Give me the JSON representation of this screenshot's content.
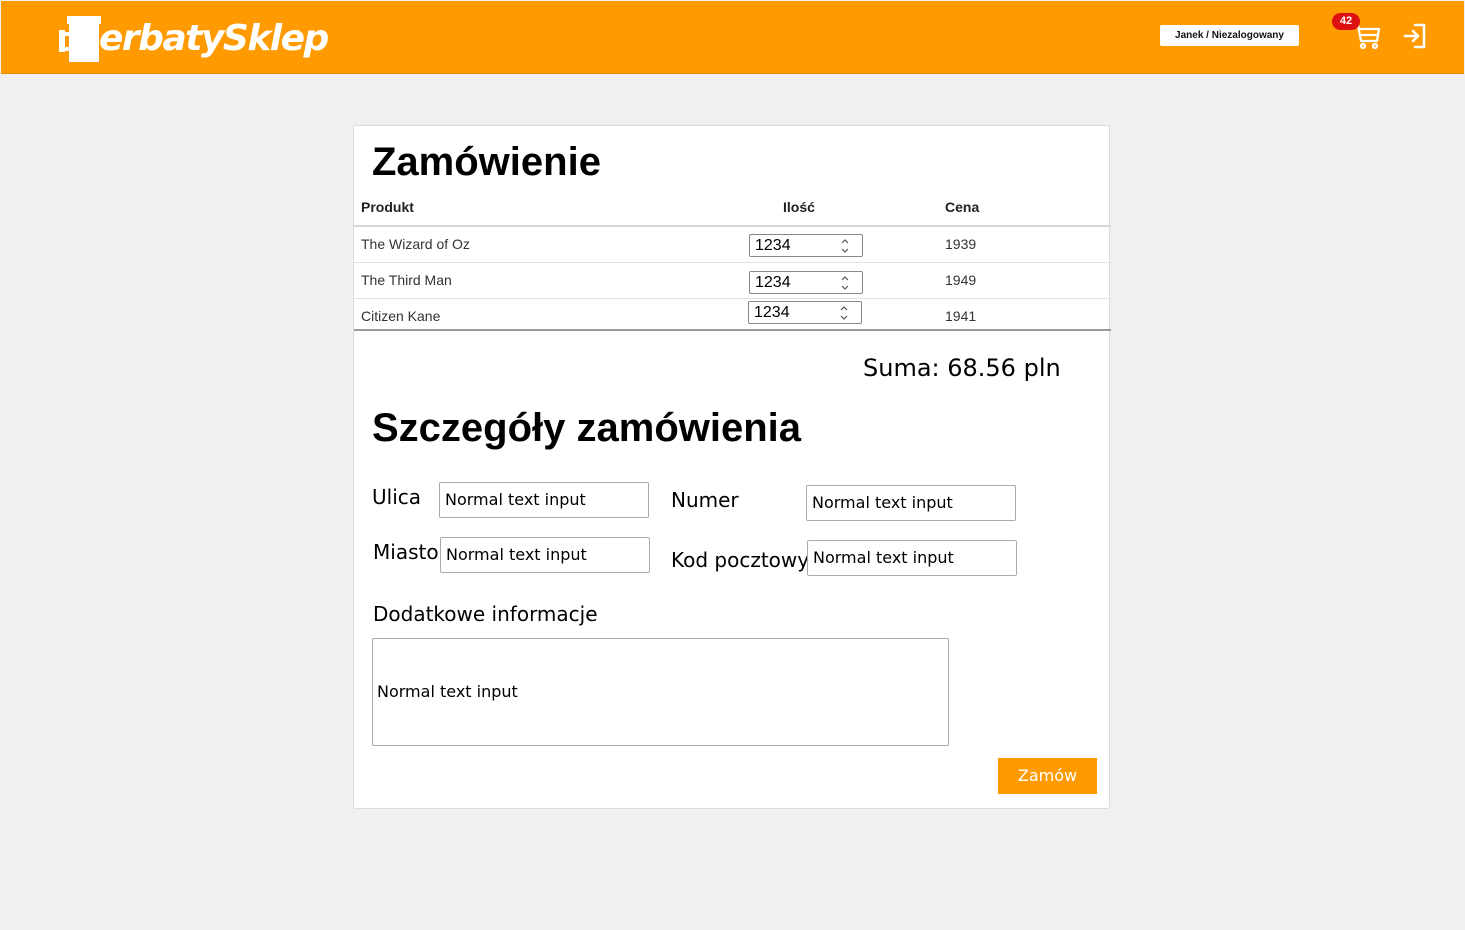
{
  "header": {
    "logo_text": "erbatySklep",
    "user_label": "Janek / Niezalogowany",
    "cart_count": "42",
    "accent_color": "#ff9b00"
  },
  "order": {
    "title": "Zamówienie",
    "columns": {
      "product": "Produkt",
      "quantity": "Ilość",
      "price": "Cena"
    },
    "items": [
      {
        "name": "The Wizard of Oz",
        "quantity": "1234",
        "price": "1939"
      },
      {
        "name": "The Third Man",
        "quantity": "1234",
        "price": "1949"
      },
      {
        "name": "Citizen Kane",
        "quantity": "1234",
        "price": "1941"
      }
    ],
    "total": "Suma: 68.56 pln"
  },
  "details": {
    "title": "Szczegóły zamówienia",
    "street_label": "Ulica",
    "street_value": "Normal text input",
    "number_label": "Numer",
    "number_value": "Normal text input",
    "city_label": "Miasto",
    "city_value": "Normal text input",
    "postal_label": "Kod pocztowy",
    "postal_value": "Normal text input",
    "extra_label": "Dodatkowe informacje",
    "extra_value": "Normal text input",
    "submit_label": "Zamów"
  }
}
